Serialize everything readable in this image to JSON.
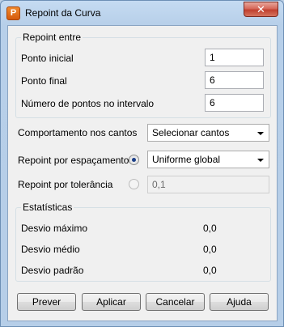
{
  "window": {
    "title": "Repoint da Curva",
    "app_icon": "P",
    "close_glyph": "✕"
  },
  "repoint_group": {
    "title": "Repoint entre",
    "start_point": {
      "label": "Ponto inicial",
      "value": "1"
    },
    "end_point": {
      "label": "Ponto final",
      "value": "6"
    },
    "num_points": {
      "label": "Número de pontos no intervalo",
      "value": "6"
    }
  },
  "corner_behavior": {
    "label": "Comportamento nos cantos",
    "selected": "Selecionar cantos"
  },
  "by_spacing": {
    "label": "Repoint por espaçamento",
    "checked": true,
    "selected": "Uniforme global"
  },
  "by_tolerance": {
    "label": "Repoint por tolerância",
    "checked": false,
    "value": "0,1"
  },
  "stats": {
    "title": "Estatísticas",
    "max_dev": {
      "label": "Desvio máximo",
      "value": "0,0"
    },
    "mean_dev": {
      "label": "Desvio médio",
      "value": "0,0"
    },
    "std_dev": {
      "label": "Desvio padrão",
      "value": "0,0"
    }
  },
  "buttons": {
    "preview": "Prever",
    "apply": "Aplicar",
    "cancel": "Cancelar",
    "help": "Ajuda"
  }
}
